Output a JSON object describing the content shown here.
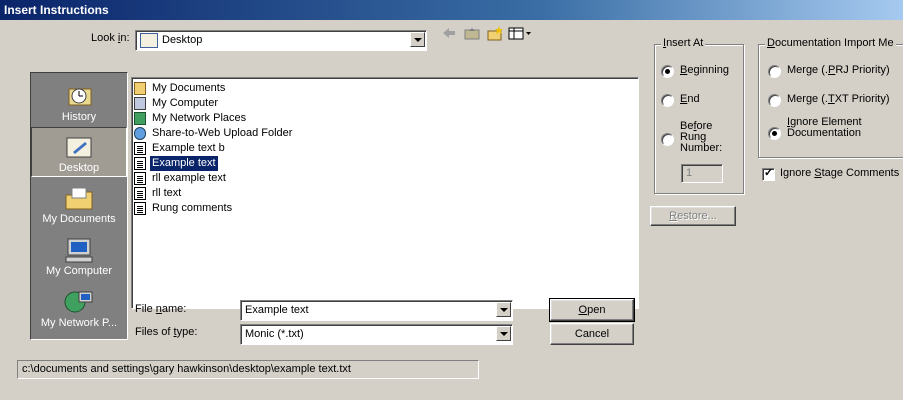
{
  "window": {
    "title": "Insert Instructions"
  },
  "look_in": {
    "label": "Look in:",
    "value": "Desktop"
  },
  "toolbar": {
    "icons": [
      "back-arrow-icon",
      "up-folder-icon",
      "new-folder-icon",
      "view-menu-icon"
    ]
  },
  "places": [
    {
      "label": "History",
      "icon": "history-icon"
    },
    {
      "label": "Desktop",
      "icon": "desktop-icon"
    },
    {
      "label": "My Documents",
      "icon": "my-documents-icon"
    },
    {
      "label": "My Computer",
      "icon": "my-computer-icon"
    },
    {
      "label": "My Network P...",
      "icon": "network-icon"
    }
  ],
  "files": [
    {
      "name": "My Documents",
      "icon": "folder-icon"
    },
    {
      "name": "My Computer",
      "icon": "computer-icon"
    },
    {
      "name": "My Network Places",
      "icon": "network-icon"
    },
    {
      "name": "Share-to-Web Upload Folder",
      "icon": "web-folder-icon"
    },
    {
      "name": "Example text b",
      "icon": "text-file-icon"
    },
    {
      "name": "Example text",
      "icon": "text-file-icon"
    },
    {
      "name": "rll example text",
      "icon": "text-file-icon"
    },
    {
      "name": "rll text",
      "icon": "text-file-icon"
    },
    {
      "name": "Rung comments",
      "icon": "text-file-icon"
    }
  ],
  "file_name": {
    "label_pre": "File ",
    "label_u": "n",
    "label_post": "ame:",
    "value": "Example text"
  },
  "file_type": {
    "label_pre": "Files of ",
    "label_u": "t",
    "label_post": "ype:",
    "value": "Monic (*.txt)"
  },
  "buttons": {
    "open_u": "O",
    "open_rest": "pen",
    "cancel": "Cancel",
    "restore_u": "R",
    "restore_rest": "estore..."
  },
  "insert_at": {
    "title_u": "I",
    "title_rest": "nsert At",
    "beginning_u": "B",
    "beginning_rest": "eginning",
    "end_u": "E",
    "end_rest": "nd",
    "before_line1_pre": "Be",
    "before_line1_u": "f",
    "before_line1_post": "ore",
    "before_line2": "Rung",
    "before_line3": "Number:",
    "rung_number": "1"
  },
  "doc_import": {
    "title_u": "D",
    "title_rest": "ocumentation Import Me",
    "merge_prj_pre": "Merge (.",
    "merge_prj_u": "P",
    "merge_prj_post": "RJ Priority)",
    "merge_txt_pre": "Merge (.",
    "merge_txt_u": "T",
    "merge_txt_post": "XT Priority)",
    "ignore_line1_u": "I",
    "ignore_line1_rest": "gnore Element",
    "ignore_line2": "Documentation"
  },
  "ignore_stage": {
    "pre": "Ignore ",
    "u": "S",
    "post": "tage Comments"
  },
  "status_path": "c:\\documents and settings\\gary hawkinson\\desktop\\example text.txt"
}
